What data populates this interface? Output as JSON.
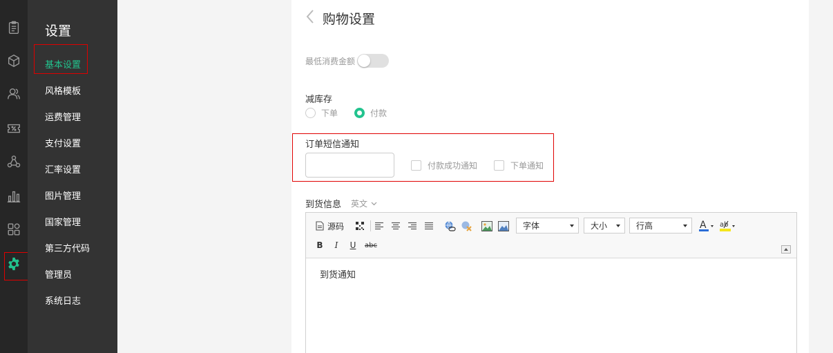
{
  "rail": {
    "icons": [
      "clipboard-icon",
      "box-icon",
      "users-icon",
      "coupon-icon",
      "share-nodes-icon",
      "bar-chart-icon",
      "apps-icon",
      "gear-icon"
    ],
    "active_color": "#22c38e"
  },
  "menu": {
    "title": "设置",
    "items": [
      {
        "label": "基本设置",
        "active": true
      },
      {
        "label": "风格模板"
      },
      {
        "label": "运费管理"
      },
      {
        "label": "支付设置"
      },
      {
        "label": "汇率设置"
      },
      {
        "label": "图片管理"
      },
      {
        "label": "国家管理"
      },
      {
        "label": "第三方代码"
      },
      {
        "label": "管理员"
      },
      {
        "label": "系统日志"
      }
    ]
  },
  "page": {
    "title": "购物设置",
    "min_amount": {
      "label": "最低消费金额",
      "enabled": false
    },
    "stock": {
      "label": "减库存",
      "options": [
        {
          "label": "下单",
          "selected": false
        },
        {
          "label": "付款",
          "selected": true
        }
      ]
    },
    "sms": {
      "label": "订单短信通知",
      "input_value": "",
      "checkboxes": [
        {
          "label": "付款成功通知",
          "checked": false
        },
        {
          "label": "下单通知",
          "checked": false
        }
      ]
    },
    "arrival": {
      "label": "到货信息",
      "language": "英文",
      "editor": {
        "source_label": "源码",
        "font_combo": "字体",
        "size_combo": "大小",
        "line_height_combo": "行高",
        "bold": "B",
        "italic": "I",
        "underline": "U",
        "strike": "abc",
        "content": "到货通知"
      }
    }
  },
  "colors": {
    "accent": "#22c38e",
    "highlight_border": "#e00000"
  }
}
